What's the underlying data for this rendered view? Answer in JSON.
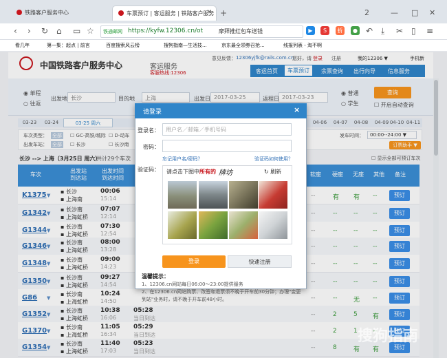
{
  "browser": {
    "tab1": "铁路客户服务中心",
    "tab2": "车票预订 | 客运服务 | 铁路客户服务",
    "new_tab": "+",
    "url": "https://kyfw.12306.cn/ot",
    "secure_label": "铁通邮网",
    "search_hint": "摩拜推红包车送钱",
    "win_min": "—",
    "win_max": "□",
    "win_close": "✕",
    "win_num": "2",
    "bookmarks": [
      "看几年",
      "第一集：起点 | 前言",
      "百度搜索风云榜",
      "搜狗指南—生活技...",
      "京东最全领券召抢...",
      "线报列表 - 淘不啊"
    ]
  },
  "site": {
    "name": "中国铁路客户服务中心",
    "section": "客运服务",
    "hotline": "客服热线:12306",
    "feedback_label": "意见反馈：",
    "feedback_email": "12306yjfk@rails.com.cn",
    "greeting": "您好，请",
    "login": "登录",
    "register": "注册",
    "my12306": "我的12306 ▼",
    "mobile": "手机新",
    "nav": [
      "客运首页",
      "车票预订",
      "余票查询",
      "出行向导",
      "信息服务"
    ]
  },
  "search": {
    "oneway": "单程",
    "round": "往返",
    "from_label": "出发地",
    "from_value": "长沙",
    "to_label": "目的地",
    "to_value": "上海",
    "date_label": "出发日",
    "date_value": "2017-03-25",
    "return_label": "返程日",
    "return_value": "2017-03-23",
    "normal": "普通",
    "student": "学生",
    "query_button": "查询",
    "auto_query": "开启自动查询"
  },
  "dates": {
    "left": [
      "03-23",
      "03-24"
    ],
    "active": "03-25 周六",
    "right": [
      "04-06",
      "04-07",
      "04-08",
      "04-09",
      "04-10",
      "04-11"
    ]
  },
  "filter": {
    "type_label": "车次类型：",
    "station_label": "出发车站：",
    "all": "全部",
    "opt1": "GC-高铁/城际",
    "opt2": "D-动车",
    "station1": "长沙",
    "station2": "长沙南",
    "depart_time_label": "发车时间：",
    "depart_time_value": "00:00--24:00 ▼",
    "order_label": "订票助手 ▼"
  },
  "summary": {
    "route": "长沙 --> 上海（3月25日 周六）",
    "count": "共计29个车次",
    "show_all": "显示全部可预订车次"
  },
  "table": {
    "headers": [
      "车次",
      "出发站\n到达站",
      "出发时间\n到达时间",
      "",
      "软座",
      "硬座",
      "无座",
      "其他",
      "备注"
    ],
    "rows": [
      {
        "no": "K1375",
        "s1": "长沙",
        "s2": "上海南",
        "t1": "00:06",
        "t2": "15:14",
        "c1": "--",
        "c2": "有",
        "c3": "有",
        "c4": "--"
      },
      {
        "no": "G1342",
        "s1": "长沙南",
        "s2": "上海虹桥",
        "t1": "07:07",
        "t2": "12:14",
        "c1": "--",
        "c2": "--",
        "c3": "--",
        "c4": "--"
      },
      {
        "no": "G1344",
        "s1": "长沙南",
        "s2": "上海虹桥",
        "t1": "07:30",
        "t2": "12:54",
        "c1": "--",
        "c2": "--",
        "c3": "--",
        "c4": "--"
      },
      {
        "no": "G1346",
        "s1": "长沙南",
        "s2": "上海虹桥",
        "t1": "08:00",
        "t2": "13:28",
        "c1": "--",
        "c2": "--",
        "c3": "--",
        "c4": "--"
      },
      {
        "no": "G1348",
        "s1": "长沙南",
        "s2": "上海虹桥",
        "t1": "09:00",
        "t2": "14:23",
        "c1": "--",
        "c2": "--",
        "c3": "--",
        "c4": "--"
      },
      {
        "no": "G1350",
        "s1": "长沙南",
        "s2": "上海虹桥",
        "t1": "09:27",
        "t2": "14:54",
        "c1": "--",
        "c2": "--",
        "c3": "--",
        "c4": "--"
      },
      {
        "no": "G86",
        "s1": "长沙南",
        "s2": "上海虹桥",
        "t1": "10:24",
        "t2": "14:50",
        "c1": "--",
        "c2": "--",
        "c3": "无",
        "c4": "--"
      },
      {
        "no": "G1352",
        "s1": "长沙南",
        "s2": "上海虹桥",
        "t1": "10:38",
        "t2": "16:06",
        "d": "05:28",
        "dn": "当日到达",
        "c1": "--",
        "c2": "2",
        "c3": "5",
        "c4": "有"
      },
      {
        "no": "G1370",
        "s1": "长沙南",
        "s2": "上海虹桥",
        "t1": "11:05",
        "t2": "16:34",
        "d": "05:29",
        "dn": "当日到达",
        "c1": "--",
        "c2": "2",
        "c3": "1",
        "c4": "--"
      },
      {
        "no": "G1354",
        "s1": "长沙南",
        "s2": "上海虹桥",
        "t1": "11:40",
        "t2": "17:03",
        "d": "05:23",
        "dn": "当日到达",
        "c1": "--",
        "c2": "8",
        "c3": "有",
        "c4": "有"
      }
    ],
    "book": "预订"
  },
  "dialog": {
    "title": "请登录",
    "close": "×",
    "user_label": "登录名：",
    "user_placeholder": "用户名／邮箱／手机号码",
    "pwd_label": "密码：",
    "forgot": "忘记用户名/密码？",
    "captcha_help": "验证码如何使用？",
    "captcha_label": "验证码：",
    "captcha_prompt": "请点击下图中",
    "captcha_emph": "所有的",
    "captcha_word": "牌坊",
    "refresh": "刷新",
    "login_button": "登录",
    "register_button": "快速注册",
    "tips_title": "温馨提示：",
    "tip1": "1、12306.cn网站每日06:00～23:00提供服务",
    "tip2": "2、在12306.cn网站购票、改签和退票须不晚于开车前30分钟；办理\"变更到站\"业务时，请不晚于开车前48小时。"
  },
  "watermark": "搜狗指南",
  "colors": {
    "brand_red": "#c8161d",
    "nav_blue": "#2f85c9",
    "orange": "#f7941d"
  }
}
